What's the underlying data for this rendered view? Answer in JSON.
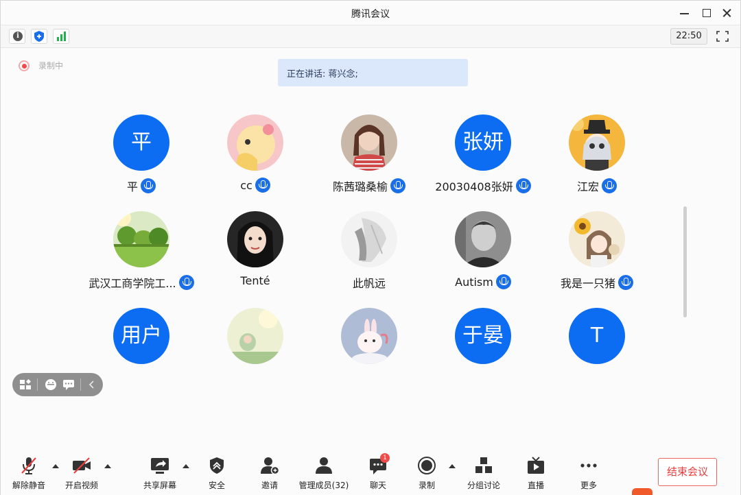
{
  "window": {
    "title": "腾讯会议"
  },
  "statusbar": {
    "icons": [
      "info-icon",
      "shield-icon",
      "signal-icon",
      "fullscreen-icon"
    ],
    "time": "22:50"
  },
  "recording": {
    "label": "录制中"
  },
  "speaking": {
    "text": "正在讲话: 蒋兴念;"
  },
  "participants": [
    {
      "name": "平",
      "avatar_text": "平",
      "avatar_type": "letter",
      "mic": true
    },
    {
      "name": "cc",
      "avatar_type": "photo",
      "mic": true
    },
    {
      "name": "陈茜璐桑榆",
      "avatar_type": "photo",
      "mic": true
    },
    {
      "name": "20030408张妍",
      "avatar_text": "张妍",
      "avatar_type": "letter",
      "mic": true
    },
    {
      "name": "江宏",
      "avatar_type": "photo",
      "mic": true
    },
    {
      "name": "武汉工商学院工...",
      "avatar_type": "photo",
      "mic": true
    },
    {
      "name": "Tenté",
      "avatar_type": "photo",
      "mic": false
    },
    {
      "name": "此帆远",
      "avatar_type": "photo",
      "mic": false
    },
    {
      "name": "Autism",
      "avatar_type": "photo",
      "mic": true
    },
    {
      "name": "我是一只猪",
      "avatar_type": "photo",
      "mic": true
    },
    {
      "name": "",
      "avatar_text": "用户",
      "avatar_type": "letter",
      "mic": false
    },
    {
      "name": "",
      "avatar_type": "photo",
      "mic": false
    },
    {
      "name": "",
      "avatar_type": "photo",
      "mic": false
    },
    {
      "name": "",
      "avatar_text": "于晏",
      "avatar_type": "letter",
      "mic": false
    },
    {
      "name": "",
      "avatar_text": "T",
      "avatar_type": "letter",
      "mic": false
    }
  ],
  "toolbar": {
    "unmute": "解除静音",
    "video": "开启视频",
    "share": "共享屏幕",
    "security": "安全",
    "invite": "邀请",
    "members": "管理成员(32)",
    "chat": "聊天",
    "chat_badge": "1",
    "record": "录制",
    "breakout": "分组讨论",
    "live": "直播",
    "more": "更多",
    "end": "结束会议"
  },
  "colors": {
    "accent": "#0c6cf2",
    "danger": "#ea3d3d",
    "banner": "#dbe8fc"
  }
}
